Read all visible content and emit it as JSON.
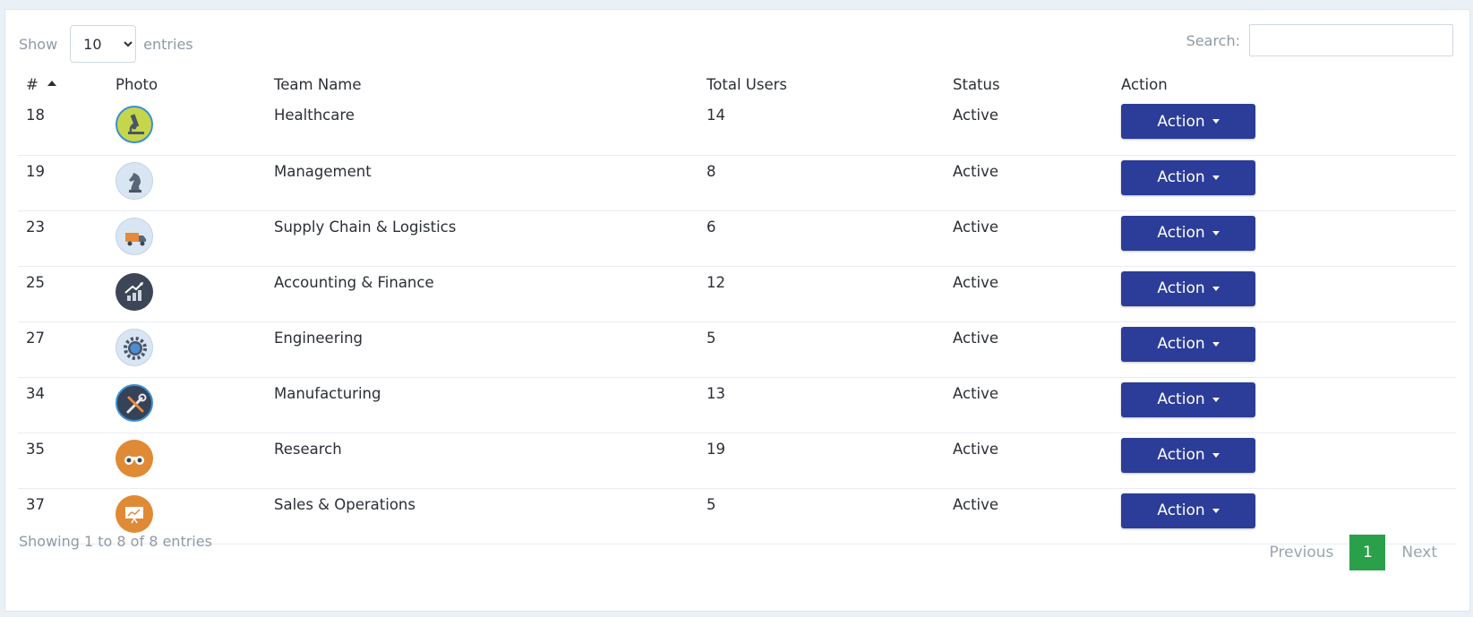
{
  "length_menu": {
    "label_before": "Show",
    "selected": "10",
    "options": [
      "10"
    ],
    "label_after": "entries"
  },
  "search": {
    "label": "Search:",
    "value": "",
    "placeholder": ""
  },
  "table": {
    "columns": [
      "#",
      "Photo",
      "Team Name",
      "Total Users",
      "Status",
      "Action"
    ],
    "sort": {
      "column": "#",
      "direction": "asc"
    },
    "rows": [
      {
        "id": "18",
        "icon": "microscope-icon",
        "name": "Healthcare",
        "users": "14",
        "status": "Active",
        "action": "Action"
      },
      {
        "id": "19",
        "icon": "chess-knight-icon",
        "name": "Management",
        "users": "8",
        "status": "Active",
        "action": "Action"
      },
      {
        "id": "23",
        "icon": "delivery-truck-icon",
        "name": "Supply Chain & Logistics",
        "users": "6",
        "status": "Active",
        "action": "Action"
      },
      {
        "id": "25",
        "icon": "growth-chart-icon",
        "name": "Accounting & Finance",
        "users": "12",
        "status": "Active",
        "action": "Action"
      },
      {
        "id": "27",
        "icon": "gear-globe-icon",
        "name": "Engineering",
        "users": "5",
        "status": "Active",
        "action": "Action"
      },
      {
        "id": "34",
        "icon": "wrench-screwdriver-icon",
        "name": "Manufacturing",
        "users": "13",
        "status": "Active",
        "action": "Action"
      },
      {
        "id": "35",
        "icon": "binoculars-icon",
        "name": "Research",
        "users": "19",
        "status": "Active",
        "action": "Action"
      },
      {
        "id": "37",
        "icon": "presentation-board-icon",
        "name": "Sales & Operations",
        "users": "5",
        "status": "Active",
        "action": "Action"
      }
    ]
  },
  "footer": {
    "info": "Showing 1 to 8 of 8 entries",
    "previous": "Previous",
    "current_page": "1",
    "next": "Next"
  },
  "colors": {
    "action_button": "#2b3d98",
    "current_page": "#2aa04a"
  }
}
